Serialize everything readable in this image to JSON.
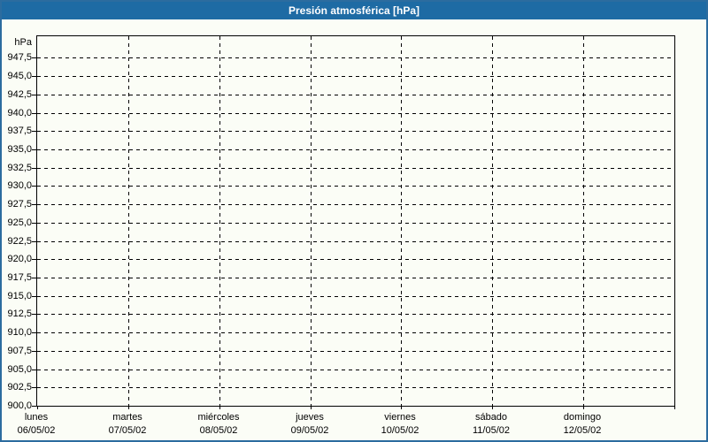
{
  "window": {
    "title": "Presión atmosférica [hPa]"
  },
  "colors": {
    "titlebar_bg": "#1e6ba4",
    "titlebar_text": "#ffffff",
    "frame_border": "#2c6c9f",
    "background": "#fbfdf6",
    "grid": "#000000",
    "axis": "#000000",
    "label_text": "#000000"
  },
  "chart_data": {
    "type": "line",
    "title": "Presión atmosférica [hPa]",
    "ylabel": "hPa",
    "xlabel": "",
    "grid": "dashed",
    "legend": "none",
    "ylim": [
      900.0,
      950.45
    ],
    "ytick_step": 2.5,
    "ytick_values": [
      900.0,
      902.5,
      905.0,
      907.5,
      910.0,
      912.5,
      915.0,
      917.5,
      920.0,
      922.5,
      925.0,
      927.5,
      930.0,
      932.5,
      935.0,
      937.5,
      940.0,
      942.5,
      945.0,
      947.5
    ],
    "ytick_labels": [
      "900,0",
      "902,5",
      "905,0",
      "907,5",
      "910,0",
      "912,5",
      "915,0",
      "917,5",
      "920,0",
      "922,5",
      "925,0",
      "927,5",
      "930,0",
      "932,5",
      "935,0",
      "937,5",
      "940,0",
      "942,5",
      "945,0",
      "947,5"
    ],
    "categories": [
      {
        "day": "lunes",
        "date": "06/05/02"
      },
      {
        "day": "martes",
        "date": "07/05/02"
      },
      {
        "day": "miércoles",
        "date": "08/05/02"
      },
      {
        "day": "jueves",
        "date": "09/05/02"
      },
      {
        "day": "viernes",
        "date": "10/05/02"
      },
      {
        "day": "sábado",
        "date": "11/05/02"
      },
      {
        "day": "domingo",
        "date": "12/05/02"
      }
    ],
    "series": []
  }
}
